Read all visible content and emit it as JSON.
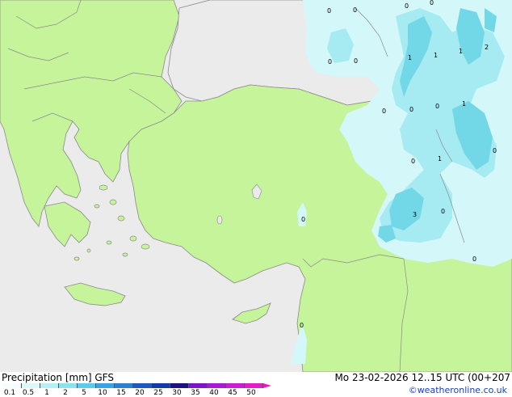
{
  "footer": {
    "title": "Precipitation [mm]  GFS",
    "datetime": "Mo 23-02-2026 12..15 UTC (00+207",
    "credit": "©weatheronline.co.uk"
  },
  "scale": {
    "ticks": [
      "0.1",
      "0.5",
      "1",
      "2",
      "5",
      "10",
      "15",
      "20",
      "25",
      "30",
      "35",
      "40",
      "45",
      "50"
    ],
    "colors": [
      "#f5fdfd",
      "#dcf8f8",
      "#b4f0f5",
      "#8ee1ef",
      "#60cbe6",
      "#3aa4e0",
      "#2d7fd0",
      "#1f58c0",
      "#123aaa",
      "#1c1280",
      "#7a16c8",
      "#a81ad6",
      "#cc1cd0",
      "#e61ac6"
    ]
  },
  "map": {
    "land_color": "#c6f49a",
    "sea_color": "#ebebeb",
    "border_color": "#8a8a8a",
    "precip_light": "#d4f7fa",
    "precip_mid": "#a6eaf2",
    "precip_heavy": "#72d8e8",
    "labels": [
      {
        "id": "p1",
        "text": "0"
      },
      {
        "id": "p2",
        "text": "0"
      },
      {
        "id": "p3",
        "text": "0"
      },
      {
        "id": "p4",
        "text": "0"
      },
      {
        "id": "p5",
        "text": "0"
      },
      {
        "id": "p6",
        "text": "0"
      },
      {
        "id": "p7",
        "text": "1"
      },
      {
        "id": "p8",
        "text": "1"
      },
      {
        "id": "p9",
        "text": "1"
      },
      {
        "id": "p10",
        "text": "2"
      },
      {
        "id": "p11",
        "text": "0"
      },
      {
        "id": "p12",
        "text": "0"
      },
      {
        "id": "p13",
        "text": "0"
      },
      {
        "id": "p14",
        "text": "1"
      },
      {
        "id": "p15",
        "text": "0"
      },
      {
        "id": "p16",
        "text": "1"
      },
      {
        "id": "p17",
        "text": "0"
      },
      {
        "id": "p18",
        "text": "3"
      },
      {
        "id": "p19",
        "text": "0"
      },
      {
        "id": "p20",
        "text": "0"
      },
      {
        "id": "p21",
        "text": "0"
      },
      {
        "id": "p22",
        "text": "0"
      },
      {
        "id": "p23",
        "text": "0"
      }
    ]
  }
}
